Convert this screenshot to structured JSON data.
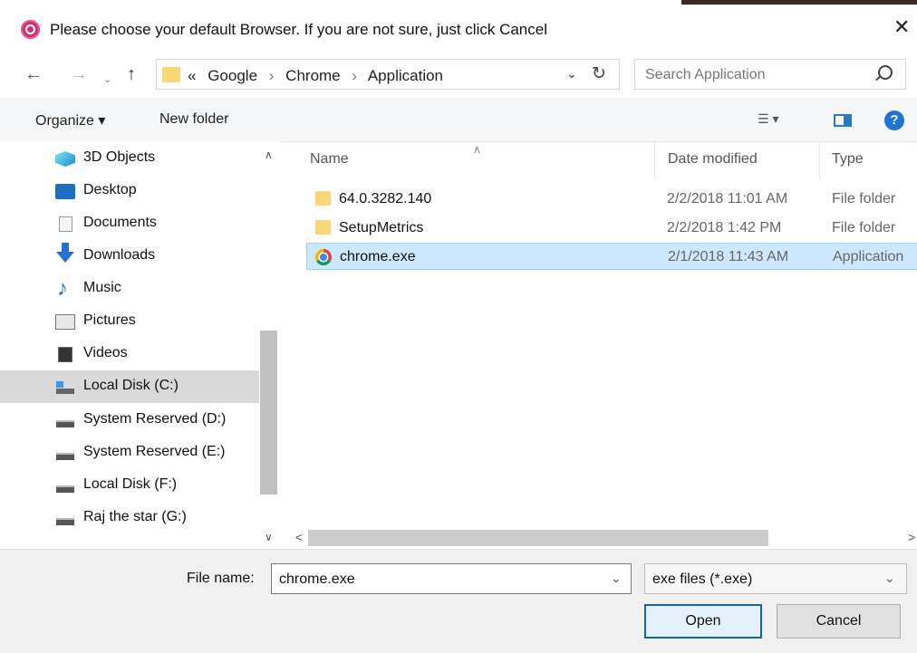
{
  "window": {
    "title": "Please choose your default Browser. If you are not sure, just click Cancel",
    "close_glyph": "✕"
  },
  "navigation": {
    "back_glyph": "←",
    "forward_glyph": "→",
    "recent_glyph": "⌄",
    "up_glyph": "↑",
    "overflow_glyph": "«",
    "breadcrumbs": [
      "Google",
      "Chrome",
      "Application"
    ],
    "separator": "›",
    "dropdown_glyph": "⌄",
    "refresh_glyph": "↻",
    "search_placeholder": "Search Application"
  },
  "toolbar": {
    "organize_label": "Organize ▾",
    "new_folder_label": "New folder",
    "view_glyph": "☰ ▾",
    "help_glyph": "?"
  },
  "sidebar": {
    "items": [
      {
        "label": "3D Objects",
        "icon": "3d-objects-icon"
      },
      {
        "label": "Desktop",
        "icon": "desktop-icon"
      },
      {
        "label": "Documents",
        "icon": "documents-icon"
      },
      {
        "label": "Downloads",
        "icon": "downloads-icon"
      },
      {
        "label": "Music",
        "icon": "music-icon"
      },
      {
        "label": "Pictures",
        "icon": "pictures-icon"
      },
      {
        "label": "Videos",
        "icon": "videos-icon"
      },
      {
        "label": "Local Disk (C:)",
        "icon": "local-disk-icon",
        "selected": true
      },
      {
        "label": "System Reserved (D:)",
        "icon": "drive-icon"
      },
      {
        "label": "System Reserved (E:)",
        "icon": "drive-icon"
      },
      {
        "label": "Local Disk (F:)",
        "icon": "drive-icon"
      },
      {
        "label": "Raj the star (G:)",
        "icon": "drive-icon"
      }
    ],
    "scroll_up_glyph": "∧",
    "scroll_down_glyph": "∨"
  },
  "file_list": {
    "columns": [
      "Name",
      "Date modified",
      "Type"
    ],
    "sort_glyph": "∧",
    "rows": [
      {
        "name": "64.0.3282.140",
        "date": "2/2/2018 11:01 AM",
        "type": "File folder",
        "icon": "folder-icon"
      },
      {
        "name": "SetupMetrics",
        "date": "2/2/2018 1:42 PM",
        "type": "File folder",
        "icon": "folder-icon"
      },
      {
        "name": "chrome.exe",
        "date": "2/1/2018 11:43 AM",
        "type": "Application",
        "icon": "chrome-icon",
        "selected": true
      }
    ],
    "scroll_left_glyph": "<",
    "scroll_right_glyph": ">"
  },
  "footer": {
    "file_name_label": "File name:",
    "file_name_value": "chrome.exe",
    "dropdown_glyph": "⌄",
    "filter_value": "exe files (*.exe)",
    "open_label": "Open",
    "cancel_label": "Cancel"
  }
}
